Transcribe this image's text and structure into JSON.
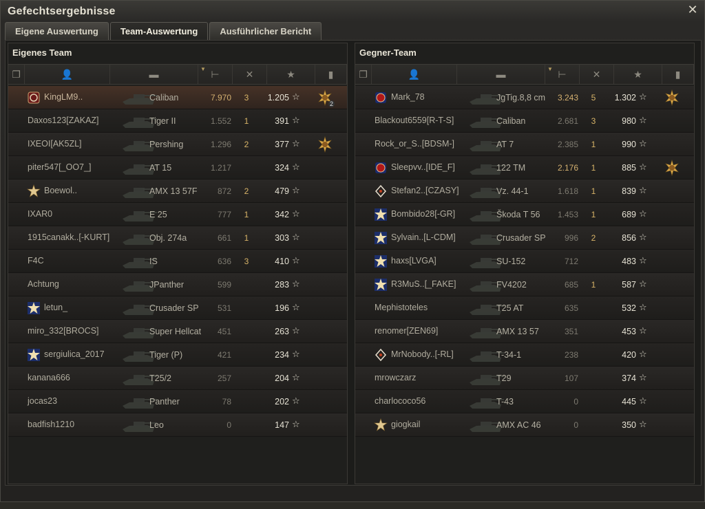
{
  "window": {
    "title": "Gefechtsergebnisse",
    "close_icon": "close-icon"
  },
  "tabs": [
    {
      "label": "Eigene Auswertung",
      "active": false
    },
    {
      "label": "Team-Auswertung",
      "active": true
    },
    {
      "label": "Ausführlicher Bericht",
      "active": false
    }
  ],
  "header_icons": [
    "squad-icon",
    "player-icon",
    "vehicle-icon",
    "damage-icon",
    "kills-icon",
    "experience-star-icon",
    "medal-icon"
  ],
  "own_team": {
    "title": "Eigenes Team",
    "rows": [
      {
        "player": "KingLM9..",
        "vehicle": "Caliban",
        "damage": "7.970",
        "kills": "3",
        "xp": "1.205",
        "badge": "clan",
        "medal": "ace-medal",
        "medal_count": "2",
        "self": true
      },
      {
        "player": "Daxos123[ZAKAZ]",
        "vehicle": "Tiger II",
        "damage": "1.552",
        "kills": "1",
        "xp": "391",
        "badge": "",
        "medal": ""
      },
      {
        "player": "IXEOI[AK5ZL]",
        "vehicle": "Pershing",
        "damage": "1.296",
        "kills": "2",
        "xp": "377",
        "badge": "",
        "medal": "ace-medal"
      },
      {
        "player": "piter547[_OO7_]",
        "vehicle": "AT 15",
        "damage": "1.217",
        "kills": "",
        "xp": "324",
        "badge": "",
        "medal": ""
      },
      {
        "player": "Boewol..",
        "vehicle": "AMX 13 57F",
        "damage": "872",
        "kills": "2",
        "xp": "479",
        "badge": "star",
        "medal": ""
      },
      {
        "player": "IXAR0",
        "vehicle": "E 25",
        "damage": "777",
        "kills": "1",
        "xp": "342",
        "badge": "",
        "medal": ""
      },
      {
        "player": "1915canakk..[-KURT]",
        "vehicle": "Obj. 274a",
        "damage": "661",
        "kills": "1",
        "xp": "303",
        "badge": "",
        "medal": ""
      },
      {
        "player": "F4C",
        "vehicle": "IS",
        "damage": "636",
        "kills": "3",
        "xp": "410",
        "badge": "",
        "medal": ""
      },
      {
        "player": "Achtung",
        "vehicle": "JPanther",
        "damage": "599",
        "kills": "",
        "xp": "283",
        "badge": "",
        "medal": ""
      },
      {
        "player": "letun_",
        "vehicle": "Crusader SP",
        "damage": "531",
        "kills": "",
        "xp": "196",
        "badge": "star-blue",
        "medal": ""
      },
      {
        "player": "miro_332[BROCS]",
        "vehicle": "Super Hellcat",
        "damage": "451",
        "kills": "",
        "xp": "263",
        "badge": "",
        "medal": ""
      },
      {
        "player": "sergiulica_2017",
        "vehicle": "Tiger (P)",
        "damage": "421",
        "kills": "",
        "xp": "234",
        "badge": "star-blue",
        "medal": ""
      },
      {
        "player": "kanana666",
        "vehicle": "T25/2",
        "damage": "257",
        "kills": "",
        "xp": "204",
        "badge": "",
        "medal": ""
      },
      {
        "player": "jocas23",
        "vehicle": "Panther",
        "damage": "78",
        "kills": "",
        "xp": "202",
        "badge": "",
        "medal": ""
      },
      {
        "player": "badfish1210",
        "vehicle": "Leo",
        "damage": "0",
        "kills": "",
        "xp": "147",
        "badge": "",
        "medal": ""
      }
    ]
  },
  "enemy_team": {
    "title": "Gegner-Team",
    "rows": [
      {
        "player": "Mark_78",
        "vehicle": "JgTig.8,8 cm",
        "damage": "3.243",
        "kills": "5",
        "xp": "1.302",
        "badge": "clan-red",
        "medal": "ace-medal",
        "top": true
      },
      {
        "player": "Blackout6559[R-T-S]",
        "vehicle": "Caliban",
        "damage": "2.681",
        "kills": "3",
        "xp": "980",
        "badge": "",
        "medal": ""
      },
      {
        "player": "Rock_or_S..[BDSM-]",
        "vehicle": "AT 7",
        "damage": "2.385",
        "kills": "1",
        "xp": "990",
        "badge": "",
        "medal": ""
      },
      {
        "player": "Sleepvv..[IDE_F]",
        "vehicle": "122 TM",
        "damage": "2.176",
        "kills": "1",
        "xp": "885",
        "badge": "clan-red",
        "medal": "ace-medal",
        "top": true
      },
      {
        "player": "Stefan2..[CZASY]",
        "vehicle": "Vz. 44-1",
        "damage": "1.618",
        "kills": "1",
        "xp": "839",
        "badge": "diamond",
        "medal": ""
      },
      {
        "player": "Bombido28[-GR]",
        "vehicle": "Škoda T 56",
        "damage": "1.453",
        "kills": "1",
        "xp": "689",
        "badge": "star-blue",
        "medal": ""
      },
      {
        "player": "Sylvain..[L-CDM]",
        "vehicle": "Crusader SP",
        "damage": "996",
        "kills": "2",
        "xp": "856",
        "badge": "star-blue",
        "medal": ""
      },
      {
        "player": "haxs[LVGA]",
        "vehicle": "SU-152",
        "damage": "712",
        "kills": "",
        "xp": "483",
        "badge": "star-blue",
        "medal": ""
      },
      {
        "player": "R3MuS..[_FAKE]",
        "vehicle": "FV4202",
        "damage": "685",
        "kills": "1",
        "xp": "587",
        "badge": "star-blue",
        "medal": ""
      },
      {
        "player": "Mephistoteles",
        "vehicle": "T25 AT",
        "damage": "635",
        "kills": "",
        "xp": "532",
        "badge": "",
        "medal": ""
      },
      {
        "player": "renomer[ZEN69]",
        "vehicle": "AMX 13 57",
        "damage": "351",
        "kills": "",
        "xp": "453",
        "badge": "",
        "medal": ""
      },
      {
        "player": "MrNobody..[-RL]",
        "vehicle": "T-34-1",
        "damage": "238",
        "kills": "",
        "xp": "420",
        "badge": "diamond",
        "medal": ""
      },
      {
        "player": "mrowczarz",
        "vehicle": "T29",
        "damage": "107",
        "kills": "",
        "xp": "374",
        "badge": "",
        "medal": ""
      },
      {
        "player": "charlococo56",
        "vehicle": "T-43",
        "damage": "0",
        "kills": "",
        "xp": "445",
        "badge": "",
        "medal": ""
      },
      {
        "player": "giogkail",
        "vehicle": "AMX AC 46",
        "damage": "0",
        "kills": "",
        "xp": "350",
        "badge": "star",
        "medal": ""
      }
    ]
  },
  "colors": {
    "accent_gold": "#d8b468",
    "self_row": "#463227",
    "text": "#b0ac9e"
  }
}
